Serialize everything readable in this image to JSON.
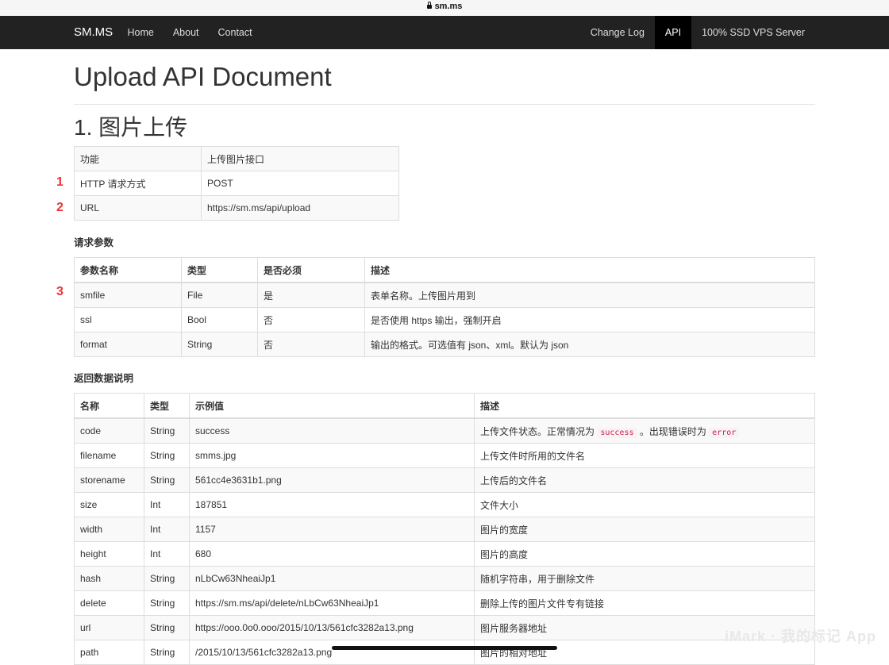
{
  "browser": {
    "url": "sm.ms"
  },
  "navbar": {
    "brand": "SM.MS",
    "left_links": [
      "Home",
      "About",
      "Contact"
    ],
    "right_links": [
      "Change Log",
      "API",
      "100% SSD VPS Server"
    ],
    "active": "API"
  },
  "page": {
    "title": "Upload API Document",
    "section_title": "1. 图片上传",
    "request_params_heading": "请求参数",
    "response_heading": "返回数据说明"
  },
  "markers": [
    "1",
    "2",
    "3"
  ],
  "info_table": [
    [
      "功能",
      "上传图片接口"
    ],
    [
      "HTTP 请求方式",
      "POST"
    ],
    [
      "URL",
      "https://sm.ms/api/upload"
    ]
  ],
  "params_table": {
    "headers": [
      "参数名称",
      "类型",
      "是否必须",
      "描述"
    ],
    "rows": [
      [
        "smfile",
        "File",
        "是",
        "表单名称。上传图片用到"
      ],
      [
        "ssl",
        "Bool",
        "否",
        "是否使用 https 输出，强制开启"
      ],
      [
        "format",
        "String",
        "否",
        "输出的格式。可选值有 json、xml。默认为 json"
      ]
    ]
  },
  "response_table": {
    "headers": [
      "名称",
      "类型",
      "示例值",
      "描述"
    ],
    "code_desc": {
      "pre": "上传文件状态。正常情况为 ",
      "code1": "success",
      "mid": " 。出现错误时为 ",
      "code2": "error"
    },
    "rows": [
      [
        "code",
        "String",
        "success",
        ""
      ],
      [
        "filename",
        "String",
        "smms.jpg",
        "上传文件时所用的文件名"
      ],
      [
        "storename",
        "String",
        "561cc4e3631b1.png",
        "上传后的文件名"
      ],
      [
        "size",
        "Int",
        "187851",
        "文件大小"
      ],
      [
        "width",
        "Int",
        "1157",
        "图片的宽度"
      ],
      [
        "height",
        "Int",
        "680",
        "图片的高度"
      ],
      [
        "hash",
        "String",
        "nLbCw63NheaiJp1",
        "随机字符串，用于删除文件"
      ],
      [
        "delete",
        "String",
        "https://sm.ms/api/delete/nLbCw63NheaiJp1",
        "删除上传的图片文件专有链接"
      ],
      [
        "url",
        "String",
        "https://ooo.0o0.ooo/2015/10/13/561cfc3282a13.png",
        "图片服务器地址"
      ],
      [
        "path",
        "String",
        "/2015/10/13/561cfc3282a13.png",
        "图片的相对地址"
      ]
    ]
  },
  "watermark": "iMark · 我的标记 App"
}
